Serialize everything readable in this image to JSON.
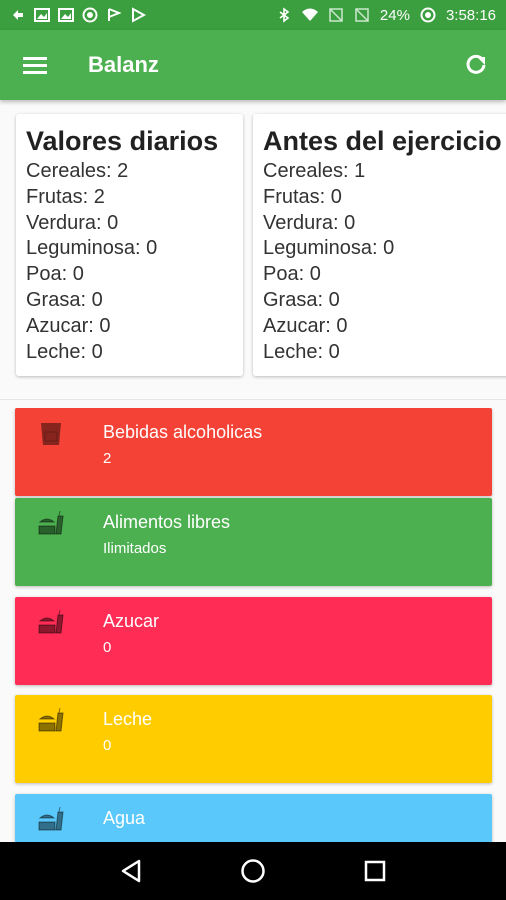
{
  "status_bar": {
    "battery": "24%",
    "time": "3:58:16"
  },
  "app_bar": {
    "title": "Balanz"
  },
  "summary_cards": [
    {
      "title": "Valores diarios",
      "rows": [
        "Cereales: 2",
        "Frutas: 2",
        "Verdura: 0",
        "Leguminosa: 0",
        "Poa: 0",
        "Grasa: 0",
        "Azucar: 0",
        "Leche: 0"
      ]
    },
    {
      "title": "Antes del ejercicio",
      "rows": [
        "Cereales: 1",
        "Frutas: 0",
        "Verdura: 0",
        "Leguminosa: 0",
        "Poa: 0",
        "Grasa: 0",
        "Azucar: 0",
        "Leche: 0"
      ]
    }
  ],
  "categories": [
    {
      "name": "Bebidas alcoholicas",
      "value": "2",
      "color": "#f44336",
      "icon": "glass-icon"
    },
    {
      "name": "Alimentos libres",
      "value": "Ilimitados",
      "color": "#4caf50",
      "icon": "fastfood-icon"
    },
    {
      "name": "Azucar",
      "value": "0",
      "color": "#ff2d55",
      "icon": "fastfood-icon"
    },
    {
      "name": "Leche",
      "value": "0",
      "color": "#ffcc00",
      "icon": "fastfood-icon"
    },
    {
      "name": "Agua",
      "value": "",
      "color": "#5ac8fa",
      "icon": "fastfood-icon"
    }
  ]
}
